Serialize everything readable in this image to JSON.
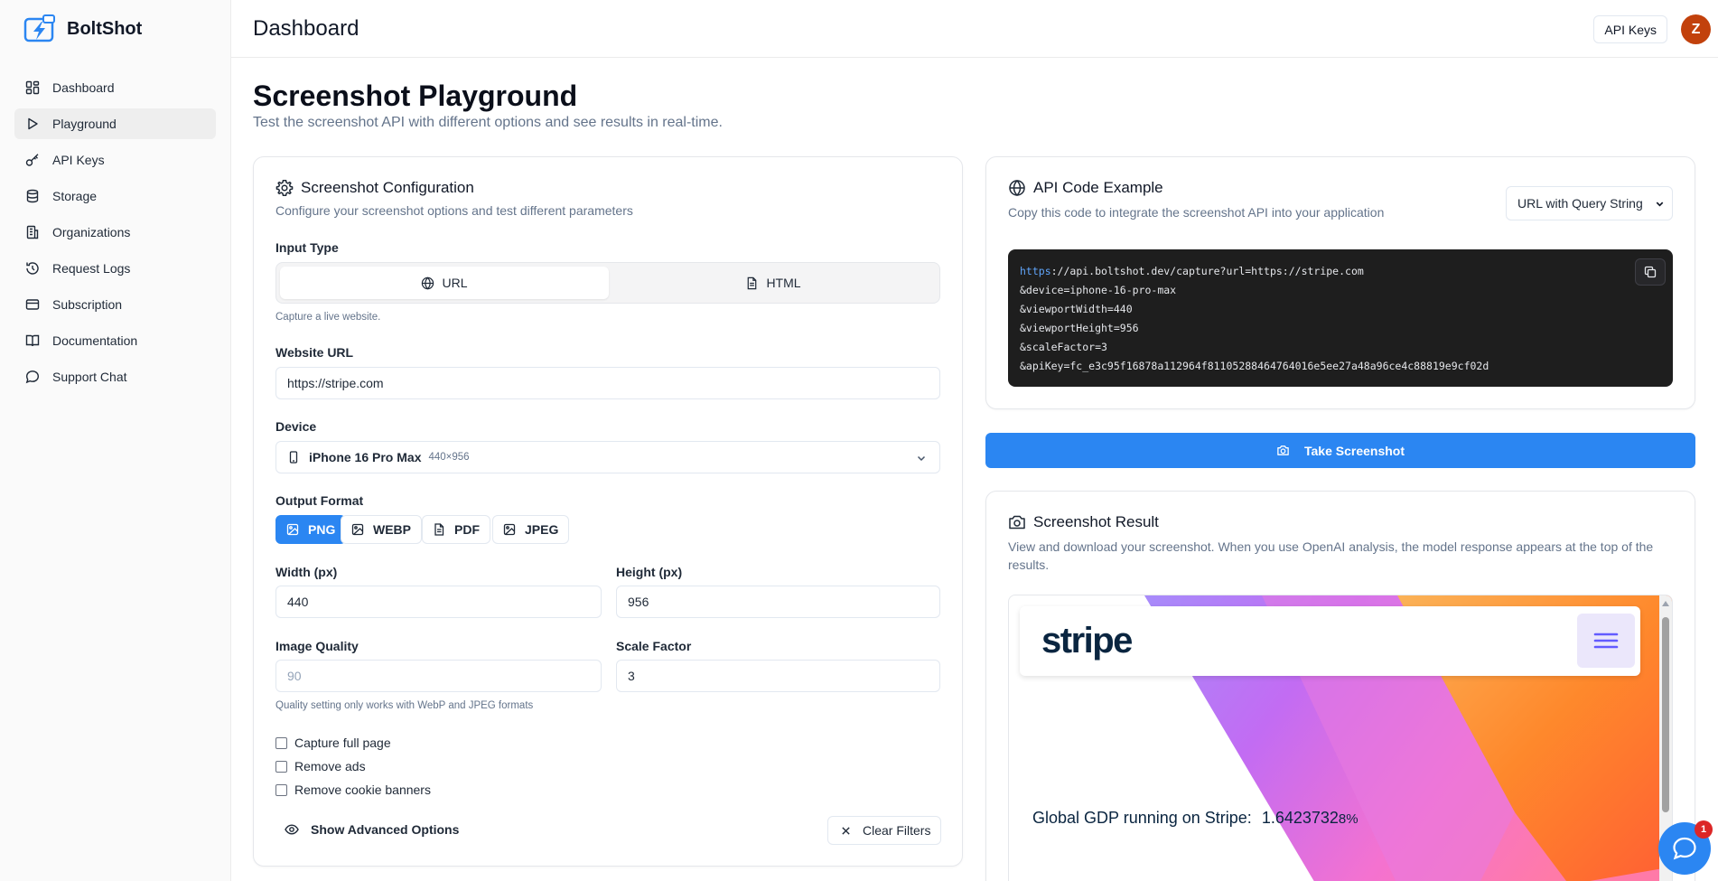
{
  "app": {
    "name": "BoltShot"
  },
  "sidebar": {
    "items": [
      {
        "label": "Dashboard",
        "icon": "dashboard-icon"
      },
      {
        "label": "Playground",
        "icon": "play-icon",
        "active": true
      },
      {
        "label": "API Keys",
        "icon": "key-icon"
      },
      {
        "label": "Storage",
        "icon": "database-icon"
      },
      {
        "label": "Organizations",
        "icon": "building-icon"
      },
      {
        "label": "Request Logs",
        "icon": "history-icon"
      },
      {
        "label": "Subscription",
        "icon": "credit-card-icon"
      },
      {
        "label": "Documentation",
        "icon": "book-icon"
      },
      {
        "label": "Support Chat",
        "icon": "message-icon"
      }
    ]
  },
  "header": {
    "title": "Dashboard",
    "api_keys_button": "API Keys",
    "avatar_initial": "Z"
  },
  "page": {
    "title": "Screenshot Playground",
    "subtitle": "Test the screenshot API with different options and see results in real-time."
  },
  "config": {
    "title": "Screenshot Configuration",
    "description": "Configure your screenshot options and test different parameters",
    "input_type_label": "Input Type",
    "input_types": [
      "URL",
      "HTML"
    ],
    "input_type_selected": "URL",
    "input_type_hint": "Capture a live website.",
    "website_url_label": "Website URL",
    "website_url_value": "https://stripe.com",
    "device_label": "Device",
    "device_value": "iPhone 16 Pro Max",
    "device_size": "440×956",
    "output_format_label": "Output Format",
    "formats": [
      "PNG",
      "WEBP",
      "PDF",
      "JPEG"
    ],
    "format_selected": "PNG",
    "width_label": "Width (px)",
    "width_value": "440",
    "height_label": "Height (px)",
    "height_value": "956",
    "quality_label": "Image Quality",
    "quality_placeholder": "90",
    "scale_label": "Scale Factor",
    "scale_value": "3",
    "quality_hint": "Quality setting only works with WebP and JPEG formats",
    "checkboxes": [
      "Capture full page",
      "Remove ads",
      "Remove cookie banners"
    ],
    "advanced_label": "Show Advanced Options",
    "clear_label": "Clear Filters"
  },
  "api_example": {
    "title": "API Code Example",
    "description": "Copy this code to integrate the screenshot API into your application",
    "mode_select": "URL with Query String",
    "code_proto": "https",
    "code_lines": [
      "://api.boltshot.dev/capture?url=https://stripe.com",
      "&device=iphone-16-pro-max",
      "&viewportWidth=440",
      "&viewportHeight=956",
      "&scaleFactor=3",
      "&apiKey=fc_e3c95f16878a112964f81105288464764016e5ee27a48a96ce4c88819e9cf02d"
    ]
  },
  "take_screenshot_label": "Take Screenshot",
  "result": {
    "title": "Screenshot Result",
    "description": "View and download your screenshot. When you use OpenAI analysis, the model response appears at the top of the results.",
    "preview_logo": "stripe",
    "preview_gdp_text": "Global GDP running on Stripe:",
    "preview_gdp_value": "1.6423732",
    "preview_gdp_tail": "8%"
  },
  "chat": {
    "badge_count": "1"
  },
  "colors": {
    "accent": "#2b86f2",
    "avatar": "#c2410c",
    "code_bg": "#1e1e1e",
    "badge": "#dc2626"
  }
}
